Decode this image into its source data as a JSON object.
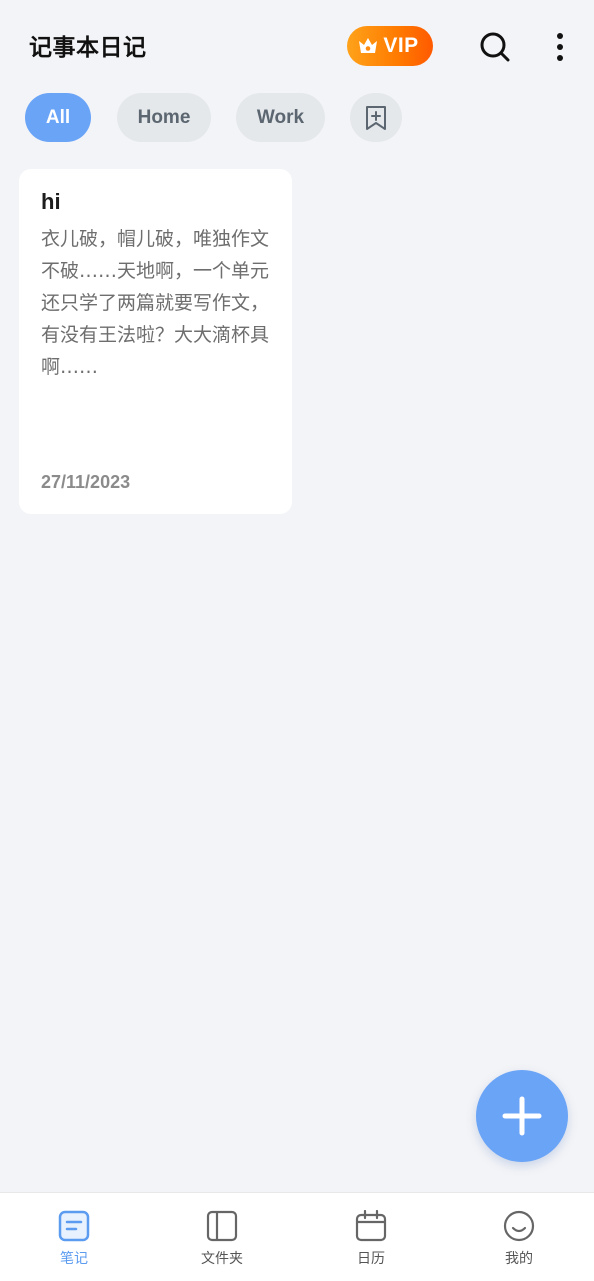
{
  "app_bar": {
    "title": "记事本日记",
    "vip_label": "VIP",
    "vip_icon": "crown-icon",
    "search_icon": "search-icon",
    "more_icon": "more-vertical-icon"
  },
  "filters": [
    {
      "label": "All",
      "active": true
    },
    {
      "label": "Home",
      "active": false
    },
    {
      "label": "Work",
      "active": false
    }
  ],
  "add_filter_icon": "bookmark-add-icon",
  "notes": [
    {
      "title": "hi",
      "body": "衣儿破，帽儿破，唯独作文不破……天地啊，一个单元还只学了两篇就要写作文，有没有王法啦？大大滴杯具啊……",
      "date": "27/11/2023"
    }
  ],
  "fab_icon": "plus-icon",
  "bottom_nav": [
    {
      "label": "笔记",
      "icon": "note-icon",
      "active": true
    },
    {
      "label": "文件夹",
      "icon": "folder-icon",
      "active": false
    },
    {
      "label": "日历",
      "icon": "calendar-icon",
      "active": false
    },
    {
      "label": "我的",
      "icon": "smiley-icon",
      "active": false
    }
  ],
  "colors": {
    "accent": "#6aa4f7",
    "vip_gradient_start": "#ffa21a",
    "vip_gradient_end": "#ff5a00",
    "background": "#f3f4f7"
  }
}
